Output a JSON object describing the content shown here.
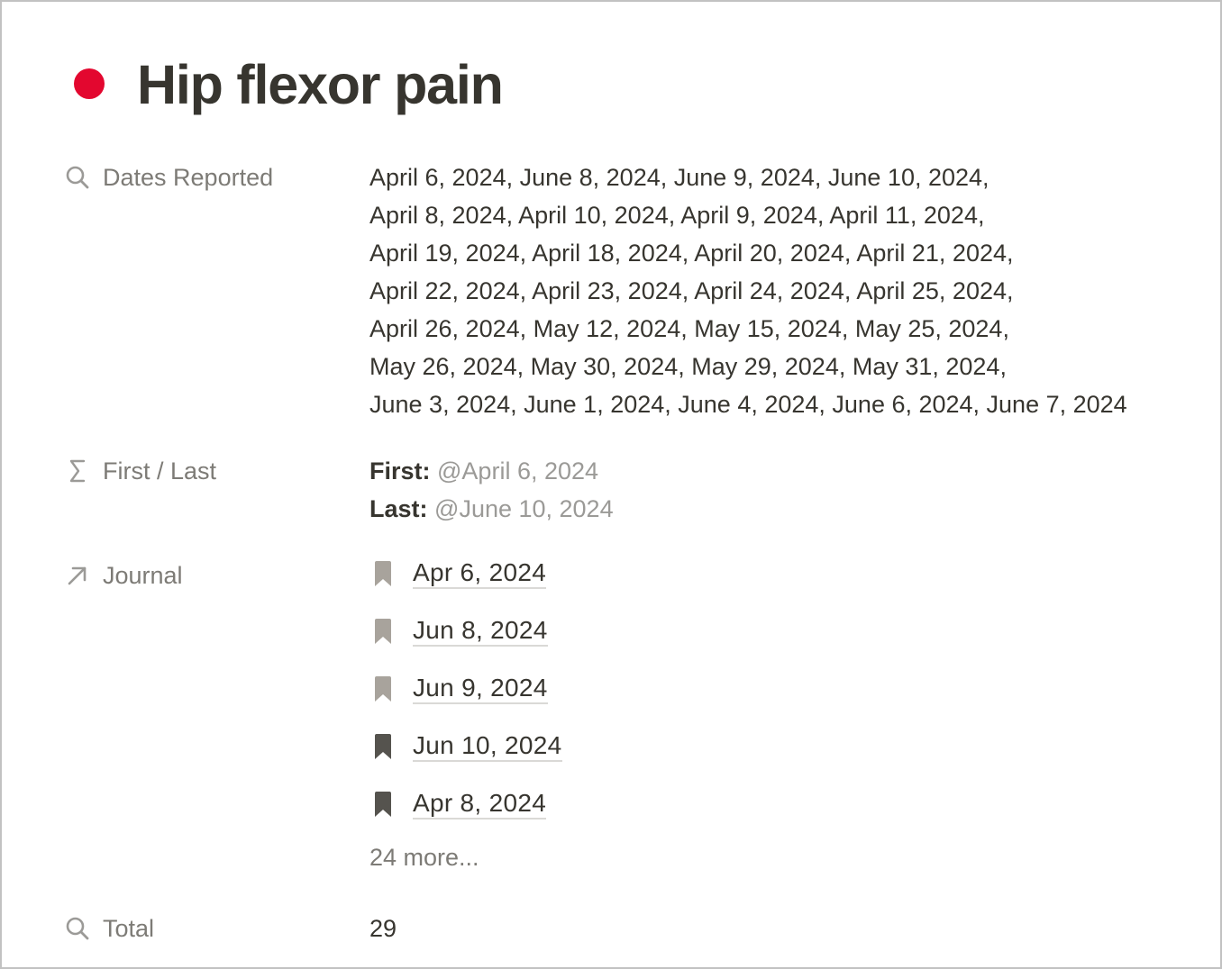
{
  "page": {
    "title": "Hip flexor pain",
    "status_dot_color": "#e3072f"
  },
  "properties": {
    "dates_reported": {
      "label": "Dates Reported",
      "icon": "search-icon",
      "lines": [
        "April 6, 2024, June 8, 2024, June 9, 2024, June 10, 2024,",
        "April 8, 2024, April 10, 2024, April 9, 2024, April 11, 2024,",
        "April 19, 2024, April 18, 2024, April 20, 2024, April 21, 2024,",
        "April 22, 2024, April 23, 2024, April 24, 2024, April 25, 2024,",
        "April 26, 2024, May 12, 2024, May 15, 2024, May 25, 2024,",
        "May 26, 2024, May 30, 2024, May 29, 2024, May 31, 2024,",
        "June 3, 2024, June 1, 2024, June 4, 2024, June 6, 2024, June 7, 2024"
      ]
    },
    "first_last": {
      "label": "First / Last",
      "icon": "sigma-icon",
      "first_label": "First:",
      "first_value": "@April 6, 2024",
      "last_label": "Last:",
      "last_value": "@June 10, 2024"
    },
    "journal": {
      "label": "Journal",
      "icon": "arrow-up-right-icon",
      "items": [
        {
          "label": "Apr 6, 2024",
          "icon_color": "#a8a39c"
        },
        {
          "label": "Jun 8, 2024",
          "icon_color": "#a8a39c"
        },
        {
          "label": "Jun 9, 2024",
          "icon_color": "#a8a39c"
        },
        {
          "label": "Jun 10, 2024",
          "icon_color": "#55534e"
        },
        {
          "label": "Apr 8, 2024",
          "icon_color": "#55534e"
        }
      ],
      "more_label": "24 more..."
    },
    "total": {
      "label": "Total",
      "icon": "search-icon",
      "value": "29"
    }
  }
}
